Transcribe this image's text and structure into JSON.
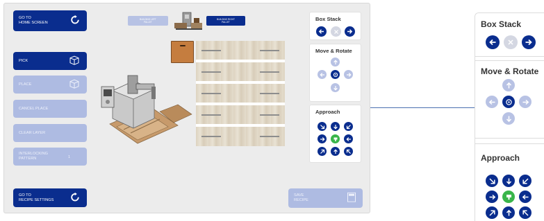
{
  "nav": {
    "home_line1": "GO TO",
    "home_line2": "HOME SCREEN",
    "recipe_line1": "GO TO",
    "recipe_line2": "RECIPE SETTINGS"
  },
  "actions": {
    "pick": "PICK",
    "place": "PLACE",
    "cancel_place": "CANCEL PLACE",
    "clear_layer": "CLEAR LAYER",
    "interlock_line1": "INTERLOCKING",
    "interlock_line2": "PATTERN",
    "interlock_value": "1",
    "save_line1": "SAVE",
    "save_line2": "RECIPE"
  },
  "preset": {
    "left_line1": "BUILDING LEFT",
    "left_line2": "PALLET",
    "right_line1": "BUILDING RIGHT",
    "right_line2": "PALLET"
  },
  "panels": {
    "box_stack": "Box Stack",
    "move_rotate": "Move & Rotate",
    "approach": "Approach"
  },
  "colors": {
    "primary": "#0a2d8e",
    "disabled": "#aebbe2",
    "approach_center": "#39b54a",
    "box": "#c57d3f",
    "connector": "#4a6fb0"
  }
}
